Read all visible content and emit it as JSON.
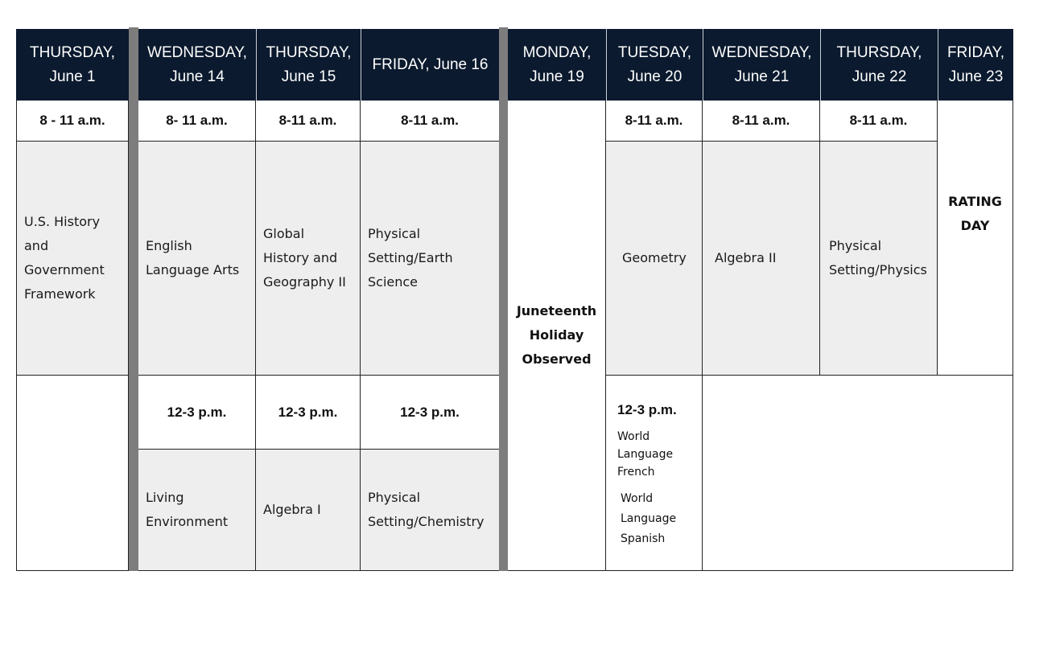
{
  "schedule": {
    "headers": [
      {
        "day": "THURSDAY,",
        "date": "June 1"
      },
      {
        "day": "WEDNESDAY,",
        "date": "June 14"
      },
      {
        "day": "THURSDAY,",
        "date": "June 15"
      },
      {
        "day": "FRIDAY, June 16",
        "date": ""
      },
      {
        "day": "MONDAY,",
        "date": "June 19"
      },
      {
        "day": "TUESDAY,",
        "date": "June 20"
      },
      {
        "day": "WEDNESDAY,",
        "date": "June 21"
      },
      {
        "day": "THURSDAY,",
        "date": "June 22"
      },
      {
        "day": "FRIDAY,",
        "date": "June 23"
      }
    ],
    "morning_times": [
      "8 - 11 a.m.",
      "8- 11 a.m.",
      "8-11 a.m.",
      "8-11 a.m.",
      "",
      "8-11 a.m.",
      "8-11 a.m.",
      "8-11 a.m.",
      ""
    ],
    "morning_exams": {
      "june1": [
        "U.S. History",
        "and",
        "Government",
        "Framework"
      ],
      "june14": [
        "English",
        "Language Arts"
      ],
      "june15": [
        "Global",
        "History and",
        "Geography II"
      ],
      "june16": [
        "Physical",
        "Setting/Earth",
        "Science"
      ],
      "june20": [
        "Geometry"
      ],
      "june21": [
        "Algebra II"
      ],
      "june22": [
        "Physical",
        "Setting/Physics"
      ]
    },
    "holiday": [
      "Juneteenth",
      "Holiday",
      "Observed"
    ],
    "rating_day": [
      "RATING",
      "DAY"
    ],
    "afternoon_times": {
      "june14": "12-3  p.m.",
      "june15": "12-3  p.m.",
      "june16": "12-3  p.m.",
      "june20": "12-3  p.m."
    },
    "afternoon_exams": {
      "june14": [
        "Living",
        "Environment"
      ],
      "june15": [
        "Algebra I"
      ],
      "june16": [
        "Physical",
        "Setting/Chemistry"
      ],
      "june20_a": [
        "World",
        "Language",
        "French"
      ],
      "june20_b": [
        "World",
        "Language",
        "Spanish"
      ]
    }
  },
  "colors": {
    "header_bg": "#0b1a2e",
    "exam_bg": "#eeeeee",
    "separator_bar": "#7d7d7d"
  }
}
